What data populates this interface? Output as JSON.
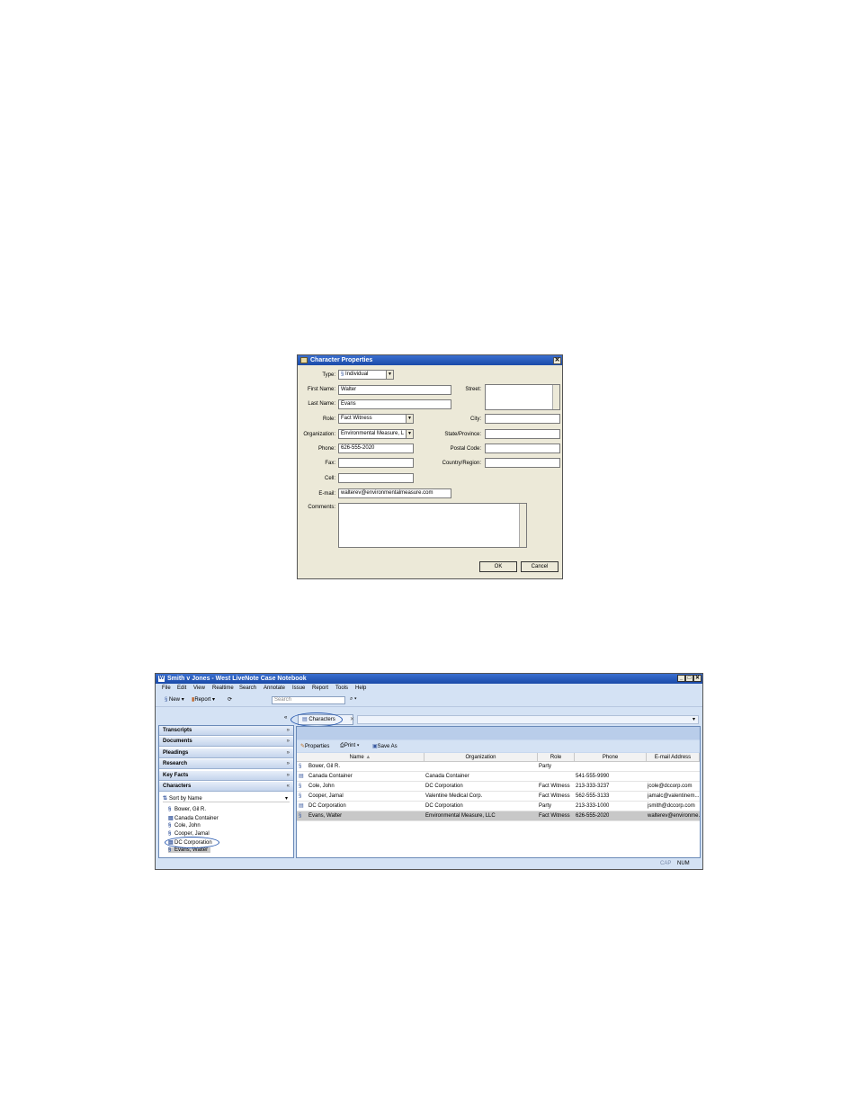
{
  "dialog": {
    "title": "Character Properties",
    "close": "✕",
    "labels": {
      "type": "Type:",
      "first_name": "First Name:",
      "last_name": "Last Name:",
      "role": "Role:",
      "organization": "Organization:",
      "phone": "Phone:",
      "fax": "Fax:",
      "cell": "Cell:",
      "email": "E-mail:",
      "comments": "Comments:",
      "street": "Street:",
      "city": "City:",
      "state": "State/Province:",
      "postal": "Postal Code:",
      "country": "Country/Region:"
    },
    "values": {
      "type": "Individual",
      "first_name": "Walter",
      "last_name": "Evans",
      "role": "Fact Witness",
      "organization": "Environmental Measure, L",
      "phone": "626-555-2020",
      "fax": "",
      "cell": "",
      "email": "walterev@environmentalmeasure.com",
      "comments": "",
      "street": "",
      "city": "",
      "state": "",
      "postal": "",
      "country": ""
    },
    "ok": "OK",
    "cancel": "Cancel"
  },
  "app": {
    "title": "Smith v Jones - West LiveNote Case Notebook",
    "menus": [
      "File",
      "Edit",
      "View",
      "Realtime",
      "Search",
      "Annotate",
      "Issue",
      "Report",
      "Tools",
      "Help"
    ],
    "toolbar": {
      "new": "New",
      "report": "Report",
      "search_placeholder": "Search"
    },
    "nav_sections": [
      "Transcripts",
      "Documents",
      "Pleadings",
      "Research",
      "Key Facts",
      "Characters"
    ],
    "sort_label": "Sort by Name",
    "tree": [
      "Bower, Gil R.",
      "Canada Container",
      "Cole, John",
      "Cooper, Jamal",
      "DC Corporation",
      "Evans, Walter"
    ],
    "tab": {
      "label": "Characters",
      "close": "✕"
    },
    "right_toolbar": {
      "properties": "Properties",
      "print": "Print",
      "save_as": "Save As"
    },
    "columns": [
      "Name",
      "Organization",
      "Role",
      "Phone",
      "E-mail Address"
    ],
    "rows": [
      {
        "name": "Bower, Gil R.",
        "org": "",
        "role": "Party",
        "phone": "",
        "email": ""
      },
      {
        "name": "Canada Container",
        "org": "Canada Container",
        "role": "",
        "phone": "541-555-9990",
        "email": ""
      },
      {
        "name": "Cole, John",
        "org": "DC Corporation",
        "role": "Fact Witness",
        "phone": "213-333-3237",
        "email": "jcole@dccorp.com"
      },
      {
        "name": "Cooper, Jamal",
        "org": "Valentine Medical Corp.",
        "role": "Fact Witness",
        "phone": "562-555-3133",
        "email": "jamalc@valentinem..."
      },
      {
        "name": "DC Corporation",
        "org": "DC Corporation",
        "role": "Party",
        "phone": "213-333-1000",
        "email": "jsmith@dccorp.com"
      },
      {
        "name": "Evans, Walter",
        "org": "Environmental Measure, LLC",
        "role": "Fact Witness",
        "phone": "626-555-2020",
        "email": "walterev@environme..."
      }
    ],
    "status": {
      "cap": "CAP",
      "num": "NUM"
    }
  }
}
